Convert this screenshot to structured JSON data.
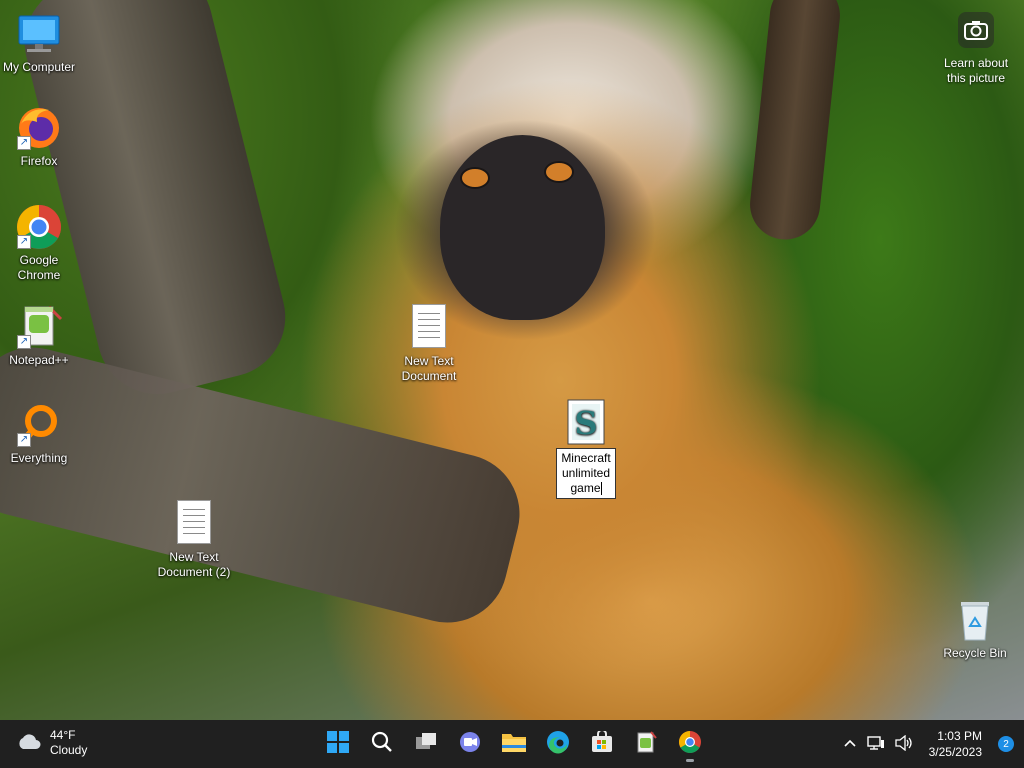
{
  "desktop": {
    "icons": [
      {
        "label": "My Computer",
        "icon": "monitor-icon"
      },
      {
        "label": "Firefox",
        "icon": "firefox-icon"
      },
      {
        "label": "Google Chrome",
        "icon": "chrome-icon"
      },
      {
        "label": "Notepad++",
        "icon": "notepad-plus-plus-icon"
      },
      {
        "label": "Everything",
        "icon": "everything-search-icon"
      },
      {
        "label": "New Text Document (2)",
        "icon": "text-document-icon"
      },
      {
        "label": "New Text Document",
        "icon": "text-document-icon"
      },
      {
        "label": "Minecraft unlimited game",
        "icon": "python-script-icon",
        "renaming": true
      },
      {
        "label": "Recycle Bin",
        "icon": "recycle-bin-icon"
      }
    ],
    "learn_picture": {
      "label_line1": "Learn about",
      "label_line2": "this picture",
      "icon": "camera-icon"
    }
  },
  "taskbar": {
    "weather": {
      "temp": "44°F",
      "condition": "Cloudy",
      "icon": "cloud-icon"
    },
    "apps": [
      {
        "name": "Start",
        "icon": "windows-start-icon"
      },
      {
        "name": "Search",
        "icon": "search-icon"
      },
      {
        "name": "Task View",
        "icon": "task-view-icon"
      },
      {
        "name": "Chat",
        "icon": "teams-chat-icon"
      },
      {
        "name": "File Explorer",
        "icon": "folder-icon"
      },
      {
        "name": "Microsoft Edge",
        "icon": "edge-icon"
      },
      {
        "name": "Microsoft Store",
        "icon": "store-icon"
      },
      {
        "name": "Notepad++",
        "icon": "notepad-plus-plus-icon"
      },
      {
        "name": "Google Chrome",
        "icon": "chrome-icon",
        "active": true
      }
    ],
    "tray": {
      "time": "1:03 PM",
      "date": "3/25/2023",
      "notifications": "2"
    }
  },
  "colors": {
    "taskbar": "#202020",
    "accent": "#1e8fe6"
  }
}
